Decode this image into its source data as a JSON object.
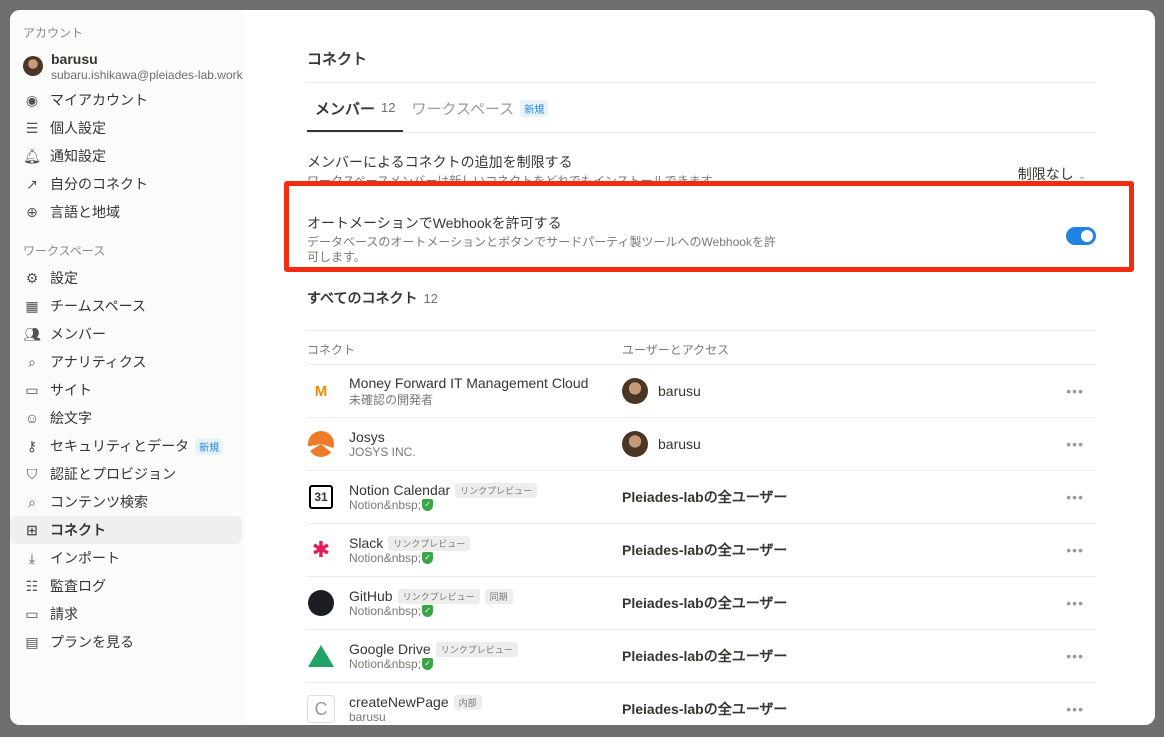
{
  "sidebar": {
    "account_label": "アカウント",
    "user": {
      "name": "barusu",
      "email": "subaru.ishikawa@pleiades-lab.work"
    },
    "account_items": [
      {
        "label": "マイアカウント",
        "icon": "user-circle-icon"
      },
      {
        "label": "個人設定",
        "icon": "sliders-icon"
      },
      {
        "label": "通知設定",
        "icon": "bell-icon"
      },
      {
        "label": "自分のコネクト",
        "icon": "arrow-box-icon"
      },
      {
        "label": "言語と地域",
        "icon": "globe-icon"
      }
    ],
    "workspace_label": "ワークスペース",
    "workspace_items": [
      {
        "label": "設定",
        "icon": "gear-icon"
      },
      {
        "label": "チームスペース",
        "icon": "building-icon"
      },
      {
        "label": "メンバー",
        "icon": "people-icon"
      },
      {
        "label": "アナリティクス",
        "icon": "zoom-chart-icon"
      },
      {
        "label": "サイト",
        "icon": "browser-icon"
      },
      {
        "label": "絵文字",
        "icon": "smile-icon"
      },
      {
        "label": "セキュリティとデータ",
        "icon": "key-icon",
        "badge": "新規"
      },
      {
        "label": "認証とプロビジョン",
        "icon": "shield-icon"
      },
      {
        "label": "コンテンツ検索",
        "icon": "search-icon"
      },
      {
        "label": "コネクト",
        "icon": "grid-icon",
        "active": true
      },
      {
        "label": "インポート",
        "icon": "download-icon"
      },
      {
        "label": "監査ログ",
        "icon": "log-icon"
      },
      {
        "label": "請求",
        "icon": "card-icon"
      },
      {
        "label": "プランを見る",
        "icon": "map-icon"
      }
    ]
  },
  "main": {
    "title": "コネクト",
    "tabs": [
      {
        "label": "メンバー",
        "count": "12"
      },
      {
        "label": "ワークスペース",
        "badge": "新規"
      }
    ],
    "restrict": {
      "title": "メンバーによるコネクトの追加を制限する",
      "desc": "ワークスペースメンバーは新しいコネクトをどれでもインストールできます。",
      "value": "制限なし"
    },
    "webhook": {
      "title": "オートメーションでWebhookを許可する",
      "desc1": "データベースのオートメーションとボタンでサードパーティ製ツールへのWebhookを許",
      "desc2": "可します。",
      "enabled": true
    },
    "all": {
      "title": "すべてのコネクト",
      "count": "12"
    },
    "columns": [
      "コネクト",
      "ユーザーとアクセス"
    ],
    "rows": [
      {
        "name": "Money Forward IT Management Cloud",
        "sub": "未確認の開発者",
        "access": "barusu",
        "avatar": true,
        "tags": []
      },
      {
        "name": "Josys",
        "sub": "JOSYS INC.",
        "access": "barusu",
        "avatar": true,
        "tags": []
      },
      {
        "name": "Notion Calendar",
        "sub": "Notion&nbsp;",
        "verified": true,
        "access": "Pleiades-labの全ユーザー",
        "tags": [
          "リンクプレビュー"
        ]
      },
      {
        "name": "Slack",
        "sub": "Notion&nbsp;",
        "verified": true,
        "access": "Pleiades-labの全ユーザー",
        "tags": [
          "リンクプレビュー"
        ]
      },
      {
        "name": "GitHub",
        "sub": "Notion&nbsp;",
        "verified": true,
        "access": "Pleiades-labの全ユーザー",
        "tags": [
          "リンクプレビュー",
          "同期"
        ]
      },
      {
        "name": "Google Drive",
        "sub": "Notion&nbsp;",
        "verified": true,
        "access": "Pleiades-labの全ユーザー",
        "tags": [
          "リンクプレビュー"
        ]
      },
      {
        "name": "createNewPage",
        "sub": "barusu",
        "access": "Pleiades-labの全ユーザー",
        "tags": [
          "内部"
        ]
      }
    ]
  },
  "colors": {
    "accent": "#2383e2",
    "highlight": "#f52b10",
    "verified": "#3aa545"
  }
}
